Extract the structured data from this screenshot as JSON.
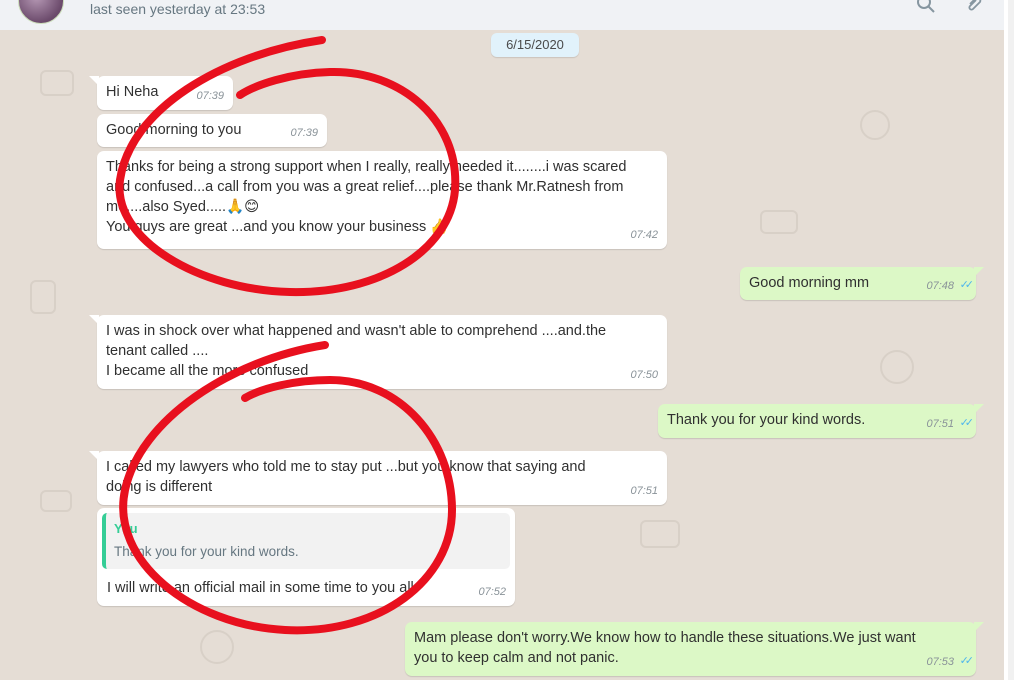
{
  "header": {
    "last_seen": "last seen yesterday at 23:53",
    "search_icon": "search-icon",
    "attach_icon": "paperclip-icon"
  },
  "chat": {
    "date": "6/15/2020",
    "messages": [
      {
        "dir": "in",
        "text": "Hi Neha",
        "time": "07:39"
      },
      {
        "dir": "in",
        "text": "Good morning to you",
        "time": "07:39"
      },
      {
        "dir": "in",
        "text_lines": [
          "Thanks for being a strong support when I really, really needed it........i was scared",
          "and confused...a call from you was a great relief....please thank Mr.Ratnesh from",
          "me....also Syed.....",
          "You guys are great ...and you know your business"
        ],
        "emojis": [
          "🙏",
          "😊",
          "👍"
        ],
        "time": "07:42"
      },
      {
        "dir": "out",
        "text": "Good morning mm",
        "time": "07:48"
      },
      {
        "dir": "in",
        "text_lines": [
          "I was in shock over what happened and wasn't able to comprehend ....and.the",
          "tenant called ....",
          "I became all the more confused"
        ],
        "time": "07:50"
      },
      {
        "dir": "out",
        "text": "Thank you for your kind words.",
        "time": "07:51"
      },
      {
        "dir": "in",
        "text_lines": [
          "I called my lawyers who told me to stay put ...but you know that saying and",
          "doing is different"
        ],
        "time": "07:51"
      },
      {
        "dir": "in",
        "quote_author": "You",
        "quote_text": "Thank you for your kind words.",
        "text": "I will write an official mail in some time to you all",
        "time": "07:52"
      },
      {
        "dir": "out",
        "text_lines": [
          "Mam please don't worry.We know how to handle these situations.We just want",
          "you to keep calm and not panic."
        ],
        "time": "07:53"
      }
    ]
  },
  "colors": {
    "incoming_bubble": "#ffffff",
    "outgoing_bubble": "#dcf8c6",
    "chat_background": "#e5ddd5",
    "read_ticks": "#4fb6ec",
    "quote_accent": "#35cd96",
    "annotation_red": "#e8101e"
  }
}
